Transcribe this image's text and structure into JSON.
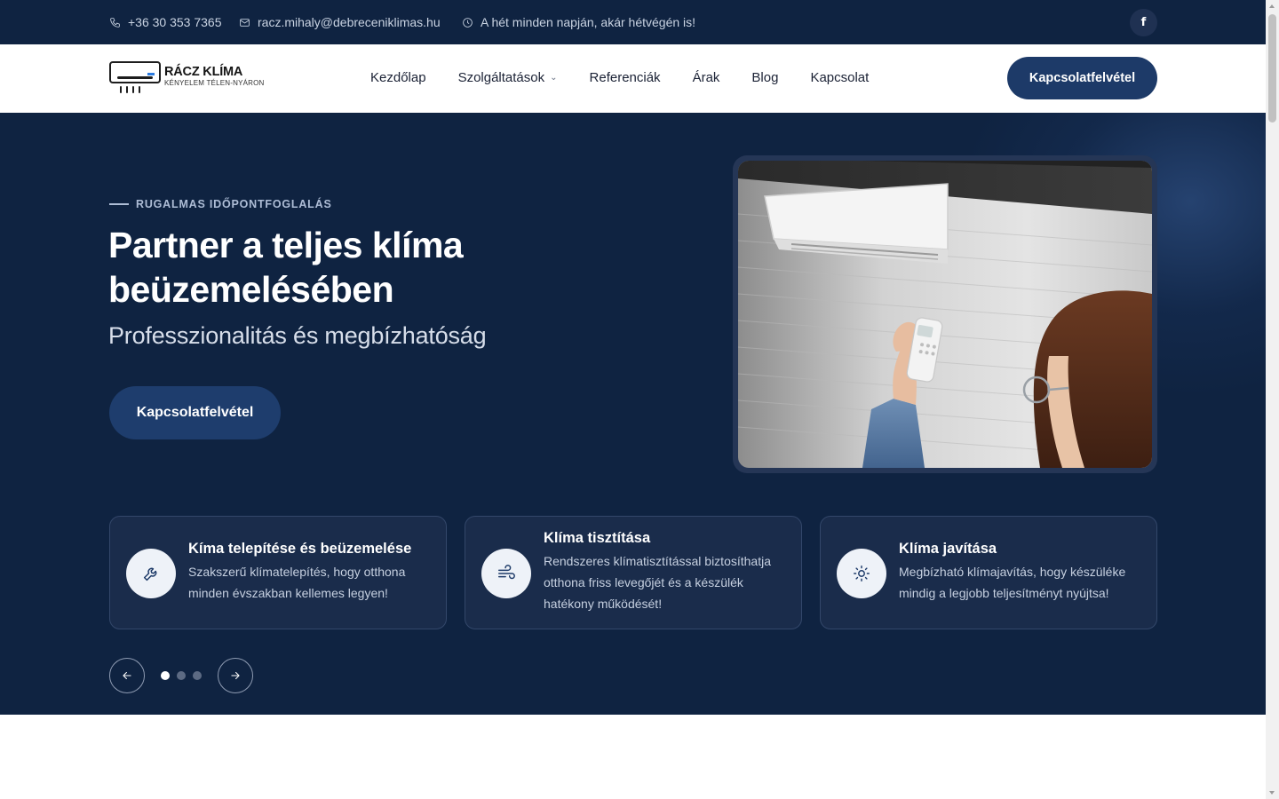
{
  "topbar": {
    "phone": "+36 30 353 7365",
    "email": "racz.mihaly@debreceniklimas.hu",
    "hours": "A hét minden napján, akár hétvégén is!",
    "facebook": "f"
  },
  "header": {
    "logo": {
      "brand": "RÁCZ KLÍMA",
      "slogan": "KÉNYELEM TÉLEN-NYÁRON"
    },
    "nav": [
      {
        "label": "Kezdőlap"
      },
      {
        "label": "Szolgáltatások",
        "dropdown": true
      },
      {
        "label": "Referenciák"
      },
      {
        "label": "Árak"
      },
      {
        "label": "Blog"
      },
      {
        "label": "Kapcsolat"
      }
    ],
    "cta": "Kapcsolatfelvétel"
  },
  "hero": {
    "eyebrow": "RUGALMAS IDŐPONTFOGLALÁS",
    "title_line1": "Partner a teljes klíma",
    "title_line2": "beüzemelésében",
    "subtitle": "Professzionalitás és megbízhatóság",
    "cta": "Kapcsolatfelvétel"
  },
  "services": [
    {
      "title": "Kíma telepítése és beüzemelése",
      "text_line1": "Szakszerű klímatelepítés, hogy otthona",
      "text_line2": "minden évszakban kellemes legyen!",
      "text_line3": "",
      "icon": "wrench-icon"
    },
    {
      "title": "Klíma tisztítása",
      "text_line1": "Rendszeres klímatisztítással biztosíthatja",
      "text_line2": "otthona friss levegőjét és a készülék",
      "text_line3": "hatékony működését!",
      "icon": "wind-icon"
    },
    {
      "title": "Klíma javítása",
      "text_line1": "Megbízható klímajavítás, hogy készüléke",
      "text_line2": "mindig a legjobb teljesítményt nyújtsa!",
      "text_line3": "",
      "icon": "sun-icon"
    }
  ],
  "slider": {
    "dots": 3,
    "active": 0
  },
  "colors": {
    "navy": "#0f2341",
    "button": "#1d3a68",
    "card": "#1a2c4b"
  }
}
